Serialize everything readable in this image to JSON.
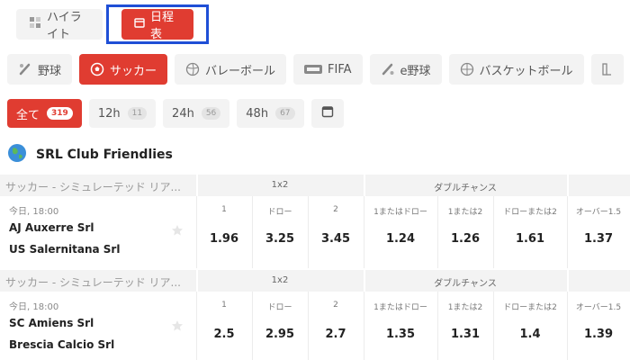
{
  "view_toggle": {
    "highlight_label": "ハイライト",
    "schedule_label": "日程表"
  },
  "sports": [
    {
      "label": "野球",
      "icon": "baseball-icon",
      "active": false
    },
    {
      "label": "サッカー",
      "icon": "soccer-ball-icon",
      "active": true
    },
    {
      "label": "バレーボール",
      "icon": "volleyball-icon",
      "active": false
    },
    {
      "label": "FIFA",
      "icon": "fifa-logo-icon",
      "active": false
    },
    {
      "label": "e野球",
      "icon": "e-baseball-icon",
      "active": false
    },
    {
      "label": "バスケットボール",
      "icon": "basketball-icon",
      "active": false
    }
  ],
  "time_filters": [
    {
      "label": "全て",
      "count": "319",
      "active": true
    },
    {
      "label": "12h",
      "count": "11",
      "active": false
    },
    {
      "label": "24h",
      "count": "56",
      "active": false
    },
    {
      "label": "48h",
      "count": "67",
      "active": false
    }
  ],
  "league": {
    "title": "SRL Club Friendlies",
    "icon": "globe-icon"
  },
  "market_headers": {
    "category": "サッカー - シミュレーテッド リア...",
    "group_1x2": "1x2",
    "group_double": "ダブルチャンス",
    "labels": [
      "1",
      "ドロー",
      "2",
      "1またはドロー",
      "1または2",
      "ドローまたは2",
      "オーバー1.5"
    ]
  },
  "matches": [
    {
      "time": "今日, 18:00",
      "home": "AJ Auxerre Srl",
      "away": "US Salernitana Srl",
      "odds": [
        "1.96",
        "3.25",
        "3.45",
        "1.24",
        "1.26",
        "1.61",
        "1.37"
      ]
    },
    {
      "time": "今日, 18:00",
      "home": "SC Amiens Srl",
      "away": "Brescia Calcio Srl",
      "odds": [
        "2.5",
        "2.95",
        "2.7",
        "1.35",
        "1.31",
        "1.4",
        "1.39"
      ]
    }
  ],
  "colors": {
    "accent": "#e03c31",
    "highlight_frame": "#1f4fd6",
    "tab_bg": "#f3f3f3"
  }
}
